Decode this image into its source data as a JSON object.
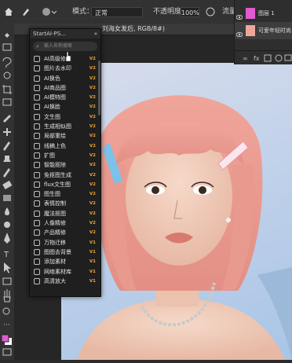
{
  "options_bar": {
    "mode_label": "模式：",
    "mode_value": "正常",
    "opacity_label": "不透明度：",
    "opacity_value": "100%",
    "flow_label": "流量"
  },
  "document_tab": {
    "title": "刘海女发后, RGB/8#)"
  },
  "layers_panel": {
    "layers": [
      {
        "name": "图层 1"
      },
      {
        "name": "可爱年轻时尚"
      }
    ]
  },
  "plugin_panel": {
    "title": "StartAI-PS...",
    "search_placeholder": "输入名称搜索",
    "items": [
      {
        "label": "AI高级修图",
        "tag": "V2"
      },
      {
        "label": "图片去水印",
        "tag": "V2"
      },
      {
        "label": "AI换色",
        "tag": "V2"
      },
      {
        "label": "AI商品图",
        "tag": "V2"
      },
      {
        "label": "AI模特图",
        "tag": "V2"
      },
      {
        "label": "AI换脸",
        "tag": "V2"
      },
      {
        "label": "文生图",
        "tag": "V2"
      },
      {
        "label": "生成相似图",
        "tag": "V2"
      },
      {
        "label": "局部重绘",
        "tag": "V2"
      },
      {
        "label": "线稿上色",
        "tag": "V2"
      },
      {
        "label": "扩图",
        "tag": "V2"
      },
      {
        "label": "智能抠除",
        "tag": "V2"
      },
      {
        "label": "免抠图生成",
        "tag": "V2"
      },
      {
        "label": "flux文生图",
        "tag": "V2"
      },
      {
        "label": "图生图",
        "tag": "V2"
      },
      {
        "label": "表情控制",
        "tag": "V2"
      },
      {
        "label": "魔法抠图",
        "tag": "V2"
      },
      {
        "label": "人像精修",
        "tag": "V2"
      },
      {
        "label": "产品精修",
        "tag": "V2"
      },
      {
        "label": "万物迁移",
        "tag": "V1"
      },
      {
        "label": "图图去背景",
        "tag": "V1"
      },
      {
        "label": "添加素材",
        "tag": "V1"
      },
      {
        "label": "网络素材库",
        "tag": "V1"
      },
      {
        "label": "高清放大",
        "tag": "V1"
      }
    ]
  },
  "colors": {
    "accent": "#e9a53a",
    "foreground_swatch": "#e05bd0",
    "background_swatch": "#ffffff"
  },
  "icons": [
    "home-icon",
    "brush-icon",
    "eye-icon",
    "search-icon"
  ]
}
